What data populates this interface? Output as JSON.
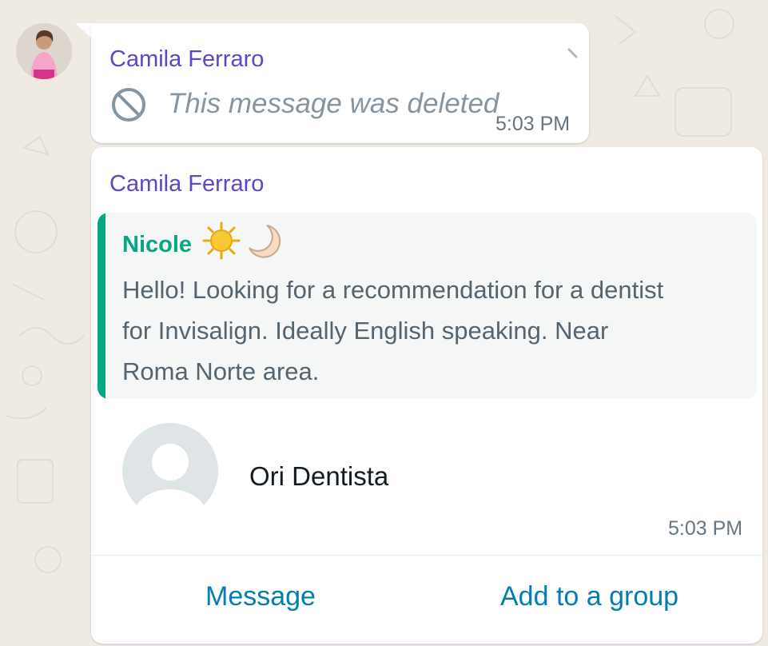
{
  "colors": {
    "chat_background": "#efeae2",
    "bubble": "#ffffff",
    "sender_name": "#6046c4",
    "quote_accent": "#06a884",
    "action_link": "#027eb5",
    "secondary_text": "#667781"
  },
  "messages": [
    {
      "sender": "Camila Ferraro",
      "deleted_icon": "prohibited-icon",
      "text": "This message was deleted",
      "time": "5:03 PM"
    },
    {
      "sender": "Camila Ferraro",
      "quoted": {
        "author": "Nicole",
        "author_emojis": [
          "sun-emoji",
          "crescent-moon-emoji"
        ],
        "text": "Hello! Looking for a recommendation for a dentist for Invisalign. Ideally English speaking. Near Roma Norte area."
      },
      "contact_card": {
        "avatar_icon": "default-avatar-icon",
        "name": "Ori Dentista",
        "time": "5:03 PM",
        "actions": {
          "message": "Message",
          "add_to_group": "Add to a group"
        }
      }
    }
  ]
}
